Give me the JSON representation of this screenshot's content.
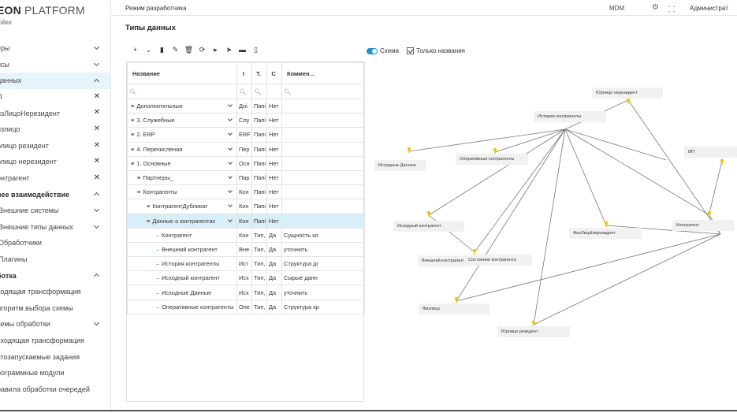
{
  "sidebar": {
    "logo_bold": "EON",
    "logo_rest": " PLATFORM",
    "logo_sub": "ойки",
    "items": [
      {
        "label": "еры",
        "ctl": "chev-down"
      },
      {
        "label": "исы",
        "ctl": "chev-down"
      },
      {
        "label": "данных",
        "ctl": "chev-up"
      },
      {
        "label": "П",
        "ctl": "x"
      },
      {
        "label": "изЛицоНерезидент",
        "ctl": "x"
      },
      {
        "label": "излицо",
        "ctl": "x"
      },
      {
        "label": "рлицо резидент",
        "ctl": "x"
      },
      {
        "label": "рлицо нерезидент",
        "ctl": "x"
      },
      {
        "label": "онтрагент",
        "ctl": "x"
      },
      {
        "label": "нее взаимодействие",
        "ctl": "chev-up"
      },
      {
        "label": "Внешние системы",
        "ctl": "chev-down"
      },
      {
        "label": "Внешние типы данных",
        "ctl": "chev-down"
      },
      {
        "label": "Обработчики",
        "ctl": ""
      },
      {
        "label": "Плагины",
        "ctl": ""
      },
      {
        "label": "ботка",
        "ctl": "chev-up"
      },
      {
        "label": "ходящая трансформация",
        "ctl": ""
      },
      {
        "label": "лгоритм выбора схемы",
        "ctl": ""
      },
      {
        "label": "хемы обработки",
        "ctl": "chev-down"
      },
      {
        "label": "сходящая трансформация",
        "ctl": ""
      },
      {
        "label": "втозапускаемые задания",
        "ctl": ""
      },
      {
        "label": "рограммные модули",
        "ctl": ""
      },
      {
        "label": "равила обработки очередей",
        "ctl": ""
      }
    ]
  },
  "topbar": {
    "mode": "Режим разработчика",
    "mdm": "MDM",
    "admin": "Администрат"
  },
  "page": {
    "title": "Типы данных"
  },
  "toolbar": {
    "icons": [
      "plus-icon",
      "chevron-down-icon",
      "stamp-icon",
      "edit-icon",
      "delete-icon",
      "refresh-icon",
      "folder-add-icon",
      "folder-move-icon",
      "folder-icon",
      "file-icon"
    ],
    "glyphs": [
      "+",
      "⌄",
      "▮",
      "✎",
      "🗑",
      "⟳",
      "▸",
      "➤",
      "▬",
      "▯"
    ]
  },
  "table": {
    "headers": [
      "Название",
      "І",
      "Т.",
      "С",
      "Коммен…"
    ],
    "rows": [
      {
        "name": "Дополнительные",
        "depth": 0,
        "kind": "group",
        "expand": true,
        "c1": "Доі",
        "c2": "Папі",
        "c3": "Нет",
        "c4": ""
      },
      {
        "name": "3. Служебные",
        "depth": 0,
        "kind": "group",
        "expand": true,
        "c1": "Слу",
        "c2": "Папі",
        "c3": "Нет",
        "c4": ""
      },
      {
        "name": "2. ERP",
        "depth": 0,
        "kind": "group",
        "expand": true,
        "c1": "ERF",
        "c2": "Папі",
        "c3": "Нет",
        "c4": ""
      },
      {
        "name": "4. Перечисления",
        "depth": 0,
        "kind": "group",
        "expand": true,
        "c1": "Пер",
        "c2": "Папі",
        "c3": "Нет",
        "c4": ""
      },
      {
        "name": "1. Основные",
        "depth": 0,
        "kind": "group",
        "expand": true,
        "c1": "Осн",
        "c2": "Папі",
        "c3": "Нет",
        "c4": ""
      },
      {
        "name": "Партнеры_",
        "depth": 1,
        "kind": "group",
        "expand": true,
        "c1": "Пар",
        "c2": "Папі",
        "c3": "Нет",
        "c4": ""
      },
      {
        "name": "Контрагенты",
        "depth": 1,
        "kind": "group",
        "expand": true,
        "c1": "Кон",
        "c2": "Папі",
        "c3": "Нет",
        "c4": ""
      },
      {
        "name": "КонтрагентДубликат",
        "depth": 2,
        "kind": "group",
        "expand": true,
        "c1": "Кон",
        "c2": "Папі",
        "c3": "Нет",
        "c4": ""
      },
      {
        "name": "Данные о контрагентах",
        "depth": 2,
        "kind": "group",
        "expand": true,
        "selected": true,
        "c1": "Кон",
        "c2": "Папі",
        "c3": "Нет",
        "c4": ""
      },
      {
        "name": "Контрагент",
        "depth": 3,
        "kind": "leaf",
        "c1": "Кон",
        "c2": "Тип,",
        "c3": "Да",
        "c4": "Сущность ко"
      },
      {
        "name": "Внешний контрагент",
        "depth": 3,
        "kind": "leaf",
        "c1": "Вне",
        "c2": "Тип,",
        "c3": "Да",
        "c4": "уточнить"
      },
      {
        "name": "История контрагенты",
        "depth": 3,
        "kind": "leaf",
        "c1": "Ист",
        "c2": "Тип,",
        "c3": "Да",
        "c4": "Структура дг"
      },
      {
        "name": "Исходный контрагент",
        "depth": 3,
        "kind": "leaf",
        "c1": "Исх",
        "c2": "Тип,",
        "c3": "Да",
        "c4": "Сырые данн"
      },
      {
        "name": "Исходные Данные",
        "depth": 3,
        "kind": "leaf",
        "c1": "Исх",
        "c2": "Тип,",
        "c3": "Да",
        "c4": "уточнить"
      },
      {
        "name": "Оперативные контрагенты",
        "depth": 3,
        "kind": "leaf",
        "c1": "Опе",
        "c2": "Тип,",
        "c3": "Да",
        "c4": "Структура хр"
      }
    ]
  },
  "graph": {
    "schema_label": "Схема",
    "only_names_label": "Только названия",
    "nodes": [
      {
        "id": "n0",
        "label": "Юрлицо нерезидент"
      },
      {
        "id": "n1",
        "label": "История контрагенты"
      },
      {
        "id": "n2",
        "label": "ИП"
      },
      {
        "id": "n3",
        "label": "Исходные Данные"
      },
      {
        "id": "n4",
        "label": "Оперативные контрагенты"
      },
      {
        "id": "n5",
        "label": "Исходный контрагент"
      },
      {
        "id": "n6",
        "label": "ФизЛицоНерезидент"
      },
      {
        "id": "n7",
        "label": "Контрагент"
      },
      {
        "id": "n8",
        "label": "Внешний контрагент"
      },
      {
        "id": "n9",
        "label": "Состояние контрагента"
      },
      {
        "id": "n10",
        "label": "Физлицо"
      },
      {
        "id": "n11",
        "label": "Юрлицо резидент"
      }
    ]
  }
}
